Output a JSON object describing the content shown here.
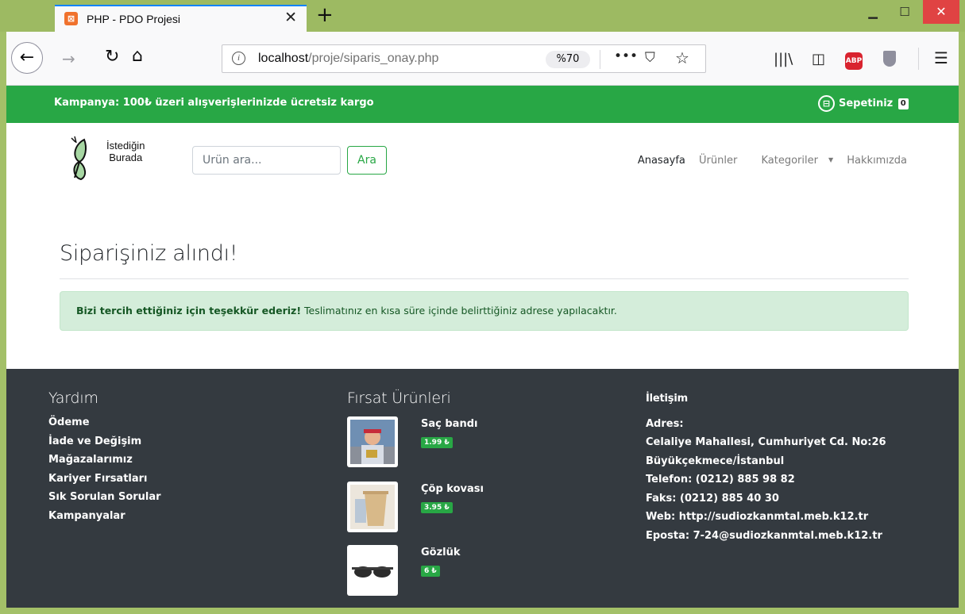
{
  "browser": {
    "tab_title": "PHP - PDO Projesi",
    "url_host": "localhost",
    "url_path": "/proje/siparis_onay.php",
    "zoom": "%70"
  },
  "promo": {
    "text": "Kampanya: 100₺ üzeri alışverişlerinizde ücretsiz kargo",
    "cart_label": "Sepetiniz",
    "cart_count": "0"
  },
  "header": {
    "logo_line1": "İstediğin",
    "logo_line2": "Burada",
    "search_placeholder": "Ürün ara...",
    "search_button": "Ara",
    "nav": [
      "Anasayfa",
      "Ürünler",
      "Kategoriler",
      "Hakkımızda"
    ]
  },
  "main": {
    "title": "Siparişiniz alındı!",
    "alert_strong": "Bizi tercih ettiğiniz için teşekkür ederiz!",
    "alert_text": " Teslimatınız en kısa süre içinde belirttiğiniz adrese yapılacaktır."
  },
  "footer": {
    "help": {
      "title": "Yardım",
      "links": [
        "Ödeme",
        "İade ve Değişim",
        "Mağazalarımız",
        "Kariyer Fırsatları",
        "Sık Sorulan Sorular",
        "Kampanyalar"
      ]
    },
    "deals": {
      "title": "Fırsat Ürünleri",
      "products": [
        {
          "name": "Saç bandı",
          "price": "1.99 ₺"
        },
        {
          "name": "Çöp kovası",
          "price": "3.95 ₺"
        },
        {
          "name": "Gözlük",
          "price": "6 ₺"
        }
      ]
    },
    "contact": {
      "title": "İletişim",
      "address_label": "Adres:",
      "address_line1": "Celaliye Mahallesi, Cumhuriyet Cd. No:26",
      "address_line2": "Büyükçekmece/İstanbul",
      "phone": "Telefon: (0212) 885 98 82",
      "fax": "Faks: (0212) 885 40 30",
      "web": "Web: http://sudiozkanmtal.meb.k12.tr",
      "email": "Eposta: 7-24@sudiozkanmtal.meb.k12.tr"
    }
  },
  "colors": {
    "brand_green": "#28a745",
    "footer_bg": "#343a40",
    "alert_bg": "#d4edda",
    "alert_text": "#155724"
  }
}
